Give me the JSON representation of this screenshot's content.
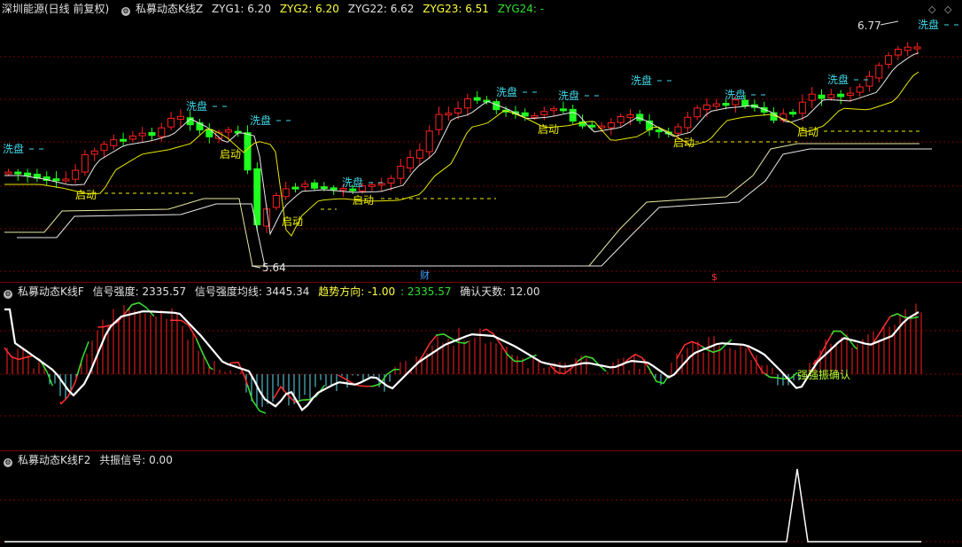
{
  "panel1": {
    "stock_name": "深圳能源(日线 前复权)",
    "indicator": "私募动态K线Z",
    "values": [
      {
        "label": "ZYG1: 6.20",
        "color": "#e0e0e0"
      },
      {
        "label": "ZYG2: 6.20",
        "color": "#ffff40"
      },
      {
        "label": "ZYG22: 6.62",
        "color": "#e0e0e0"
      },
      {
        "label": "ZYG23: 6.51",
        "color": "#ffff40"
      },
      {
        "label": "ZYG24: -",
        "color": "#30e030"
      }
    ],
    "high_label": "6.77",
    "low_label": "5.64",
    "wash_label": "洗盘",
    "start_label": "启动",
    "cai_label": "财",
    "dollar_label": "$"
  },
  "panel2": {
    "indicator": "私募动态K线F",
    "values": [
      {
        "label": "信号强度: 2335.57",
        "color": "#e0e0e0"
      },
      {
        "label": "信号强度均线: 3445.34",
        "color": "#e0e0e0"
      },
      {
        "label": "趋势方向: -1.00",
        "color": "#ffff40"
      },
      {
        "label": ": 2335.57",
        "color": "#30e030"
      },
      {
        "label": "确认天数: 12.00",
        "color": "#e0e0e0"
      }
    ],
    "resonance_label": "强强振确认"
  },
  "panel3": {
    "indicator": "私募动态K线F2",
    "values": [
      {
        "label": "共振信号: 0.00",
        "color": "#e0e0e0"
      }
    ]
  },
  "colors": {
    "up": "#ff2020",
    "down": "#20ff20",
    "bg": "#000000",
    "grid": "#7a0000"
  }
}
